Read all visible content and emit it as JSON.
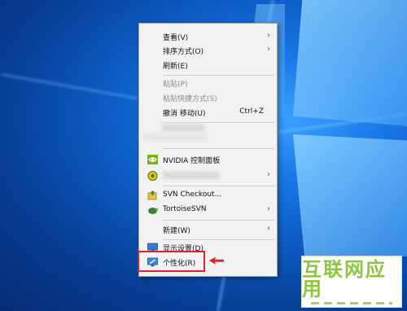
{
  "menu": {
    "items": [
      {
        "label": "查看(V)",
        "submenu": true
      },
      {
        "label": "排序方式(O)",
        "submenu": true
      },
      {
        "label": "刷新(E)"
      },
      {
        "label": "粘贴(P)",
        "disabled": true
      },
      {
        "label": "粘贴快捷方式(S)",
        "disabled": true
      },
      {
        "label": "撤消 移动(U)",
        "shortcut": "Ctrl+Z"
      },
      {
        "label": "NVIDIA 控制面板",
        "icon": "nvidia-icon"
      },
      {
        "label": "",
        "icon": "app-icon",
        "submenu": true
      },
      {
        "label": "SVN Checkout...",
        "icon": "svn-checkout-icon"
      },
      {
        "label": "TortoiseSVN",
        "icon": "tortoisesvn-icon",
        "submenu": true
      },
      {
        "label": "新建(W)",
        "submenu": true
      },
      {
        "label": "显示设置(D)",
        "icon": "display-settings-icon"
      },
      {
        "label": "个性化(R)",
        "icon": "personalize-icon",
        "highlighted": true
      }
    ],
    "arrow_glyph": "›"
  },
  "colors": {
    "highlight_border": "#e0202a",
    "menu_background": "#f2f2f2",
    "desktop_blue": "#1877e6",
    "watermark_green": "#8cc63f"
  },
  "watermark": {
    "text": "互联网应用"
  }
}
